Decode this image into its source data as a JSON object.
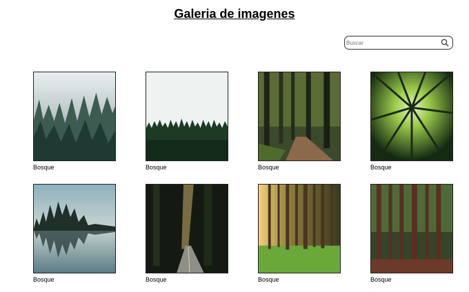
{
  "page": {
    "title": "Galeria de imagenes"
  },
  "search": {
    "placeholder": "Buscar",
    "icon": "search-icon"
  },
  "gallery": [
    {
      "caption": "Bosque",
      "image": "forest-misty-pines"
    },
    {
      "caption": "Bosque",
      "image": "forest-treeline-sky"
    },
    {
      "caption": "Bosque",
      "image": "forest-path-sunlight"
    },
    {
      "caption": "Bosque",
      "image": "forest-canopy-upward"
    },
    {
      "caption": "Bosque",
      "image": "forest-lake-reflection"
    },
    {
      "caption": "Bosque",
      "image": "forest-road-light"
    },
    {
      "caption": "Bosque",
      "image": "forest-sunset-trunks"
    },
    {
      "caption": "Bosque",
      "image": "forest-dense-trunks"
    }
  ]
}
